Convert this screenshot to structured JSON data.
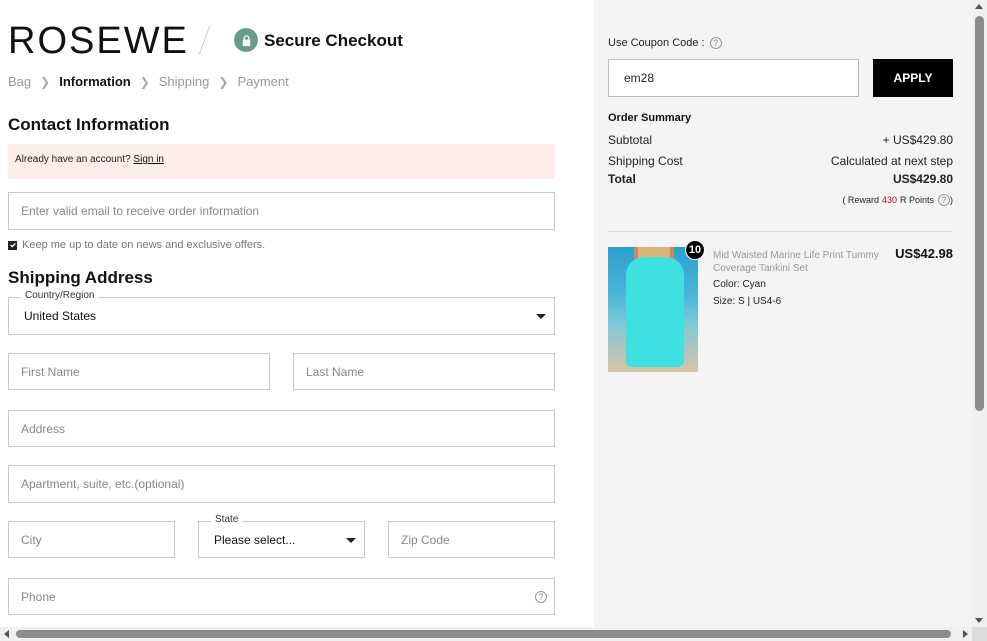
{
  "header": {
    "logo": "ROSEWE",
    "secure_label": "Secure Checkout"
  },
  "breadcrumb": [
    "Bag",
    "Information",
    "Shipping",
    "Payment"
  ],
  "contact": {
    "title": "Contact Information",
    "notice_text": "Already have an account?",
    "signin_link": "Sign in",
    "email_placeholder": "Enter valid email to receive order information",
    "keep_updated": "Keep me up to date on news and exclusive offers."
  },
  "shipping": {
    "title": "Shipping Address",
    "country_label": "Country/Region",
    "country_value": "United States",
    "first_name": "First Name",
    "last_name": "Last Name",
    "address": "Address",
    "apartment": "Apartment, suite, etc.(optional)",
    "city": "City",
    "state_label": "State",
    "state_value": "Please select...",
    "zip": "Zip Code",
    "phone": "Phone"
  },
  "coupon": {
    "label": "Use Coupon Code :",
    "value": "em28",
    "apply_label": "APPLY"
  },
  "summary": {
    "title": "Order Summary",
    "subtotal_label": "Subtotal",
    "subtotal_value": "+ US$429.80",
    "shipping_label": "Shipping Cost",
    "shipping_value": "Calculated at next step",
    "total_label": "Total",
    "total_value": "US$429.80",
    "reward_prefix": "( Reward",
    "reward_points": "430",
    "reward_suffix": "R Points"
  },
  "product": {
    "quantity": "10",
    "name": "Mid Waisted Marine Life Print Tummy Coverage Tankini Set",
    "price": "US$42.98",
    "color": "Color: Cyan",
    "size": "Size: S | US4-6"
  },
  "colors": {
    "accent_button": "#000000",
    "notice_bg": "#fdeeec",
    "summary_bg": "#f4f4f4",
    "reward_points": "#cc0000",
    "lock_badge": "#6a9d88"
  }
}
